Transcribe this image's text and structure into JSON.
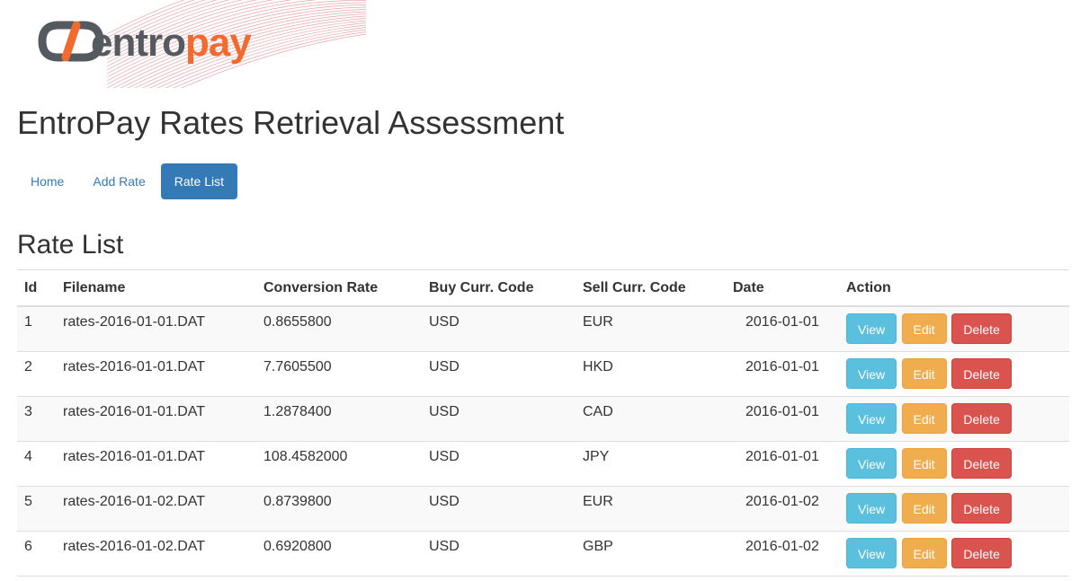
{
  "brand": {
    "logo_part1": "entro",
    "logo_part2": "pay",
    "accent_color": "#f26a2e",
    "dark_color": "#555a60"
  },
  "page": {
    "title": "EntroPay Rates Retrieval Assessment",
    "section_title": "Rate List"
  },
  "nav": {
    "items": [
      {
        "label": "Home",
        "active": false
      },
      {
        "label": "Add Rate",
        "active": false
      },
      {
        "label": "Rate List",
        "active": true
      }
    ],
    "active_color": "#337ab7"
  },
  "table": {
    "headers": [
      "Id",
      "Filename",
      "Conversion Rate",
      "Buy Curr. Code",
      "Sell Curr. Code",
      "Date",
      "Action"
    ],
    "rows": [
      {
        "id": "1",
        "filename": "rates-2016-01-01.DAT",
        "rate": "0.8655800",
        "buy": "USD",
        "sell": "EUR",
        "date": "2016-01-01"
      },
      {
        "id": "2",
        "filename": "rates-2016-01-01.DAT",
        "rate": "7.7605500",
        "buy": "USD",
        "sell": "HKD",
        "date": "2016-01-01"
      },
      {
        "id": "3",
        "filename": "rates-2016-01-01.DAT",
        "rate": "1.2878400",
        "buy": "USD",
        "sell": "CAD",
        "date": "2016-01-01"
      },
      {
        "id": "4",
        "filename": "rates-2016-01-01.DAT",
        "rate": "108.4582000",
        "buy": "USD",
        "sell": "JPY",
        "date": "2016-01-01"
      },
      {
        "id": "5",
        "filename": "rates-2016-01-02.DAT",
        "rate": "0.8739800",
        "buy": "USD",
        "sell": "EUR",
        "date": "2016-01-02"
      },
      {
        "id": "6",
        "filename": "rates-2016-01-02.DAT",
        "rate": "0.6920800",
        "buy": "USD",
        "sell": "GBP",
        "date": "2016-01-02"
      }
    ],
    "actions": {
      "view": "View",
      "edit": "Edit",
      "delete": "Delete"
    }
  }
}
